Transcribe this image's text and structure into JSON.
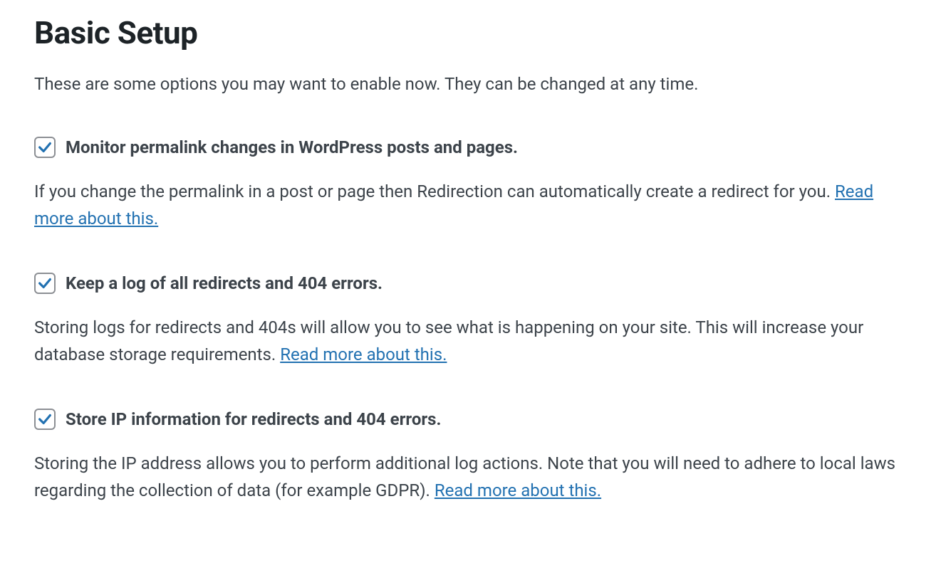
{
  "title": "Basic Setup",
  "intro": "These are some options you may want to enable now. They can be changed at any time.",
  "readMoreLabel": "Read more about this.",
  "options": [
    {
      "label": "Monitor permalink changes in WordPress posts and pages.",
      "description": "If you change the permalink in a post or page then Redirection can automatically create a redirect for you. ",
      "checked": true
    },
    {
      "label": "Keep a log of all redirects and 404 errors.",
      "description": "Storing logs for redirects and 404s will allow you to see what is happening on your site. This will increase your database storage requirements. ",
      "checked": true
    },
    {
      "label": "Store IP information for redirects and 404 errors.",
      "description": "Storing the IP address allows you to perform additional log actions. Note that you will need to adhere to local laws regarding the collection of data (for example GDPR). ",
      "checked": true
    }
  ]
}
